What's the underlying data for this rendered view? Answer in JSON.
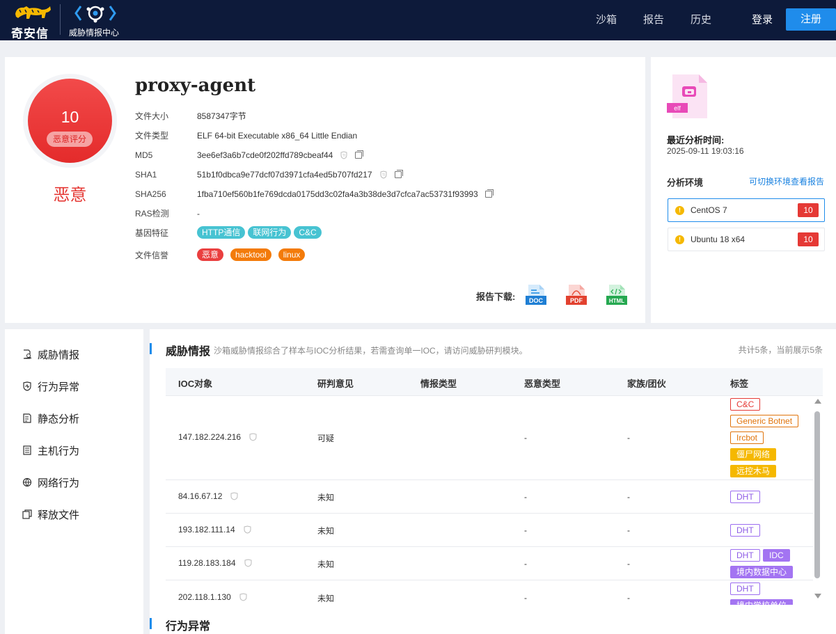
{
  "header": {
    "brand": "奇安信",
    "product": "威胁情报中心",
    "nav": [
      "沙箱",
      "报告",
      "历史"
    ],
    "login": "登录",
    "register": "注册"
  },
  "summary": {
    "score": "10",
    "score_label": "恶意评分",
    "verdict": "恶意",
    "file_name": "proxy-agent",
    "fields": {
      "size_label": "文件大小",
      "size": "8587347字节",
      "type_label": "文件类型",
      "type": "ELF 64-bit Executable x86_64 Little Endian",
      "md5_label": "MD5",
      "md5": "3ee6ef3a6b7cde0f202ffd789cbeaf44",
      "sha1_label": "SHA1",
      "sha1": "51b1f0dbca9e77dcf07d3971cfa4ed5b707fd217",
      "sha256_label": "SHA256",
      "sha256": "1fba710ef560b1fe769dcda0175dd3c02fa4a3b38de3d7cfca7ac53731f93993",
      "ras_label": "RAS检测",
      "ras": "-",
      "gene_label": "基因特征",
      "rep_label": "文件信誉"
    },
    "gene_tags": [
      "HTTP通信",
      "联网行为",
      "C&C"
    ],
    "reputation_tags": [
      "恶意",
      "hacktool",
      "linux"
    ],
    "download_label": "报告下载:",
    "downloads": [
      "DOC",
      "PDF",
      "HTML"
    ]
  },
  "analysis": {
    "file_badge": "elf",
    "latest_label": "最近分析时间:",
    "latest_time": "2025-09-11 19:03:16",
    "env_label": "分析环境",
    "env_link": "可切换环境查看报告",
    "envs": [
      {
        "name": "CentOS 7",
        "score": "10"
      },
      {
        "name": "Ubuntu 18 x64",
        "score": "10"
      }
    ]
  },
  "sidebar": [
    "威胁情报",
    "行为异常",
    "静态分析",
    "主机行为",
    "网络行为",
    "释放文件"
  ],
  "threat": {
    "title": "威胁情报",
    "desc": "沙箱威胁情报综合了样本与IOC分析结果，若需查询单一IOC，请访问威胁研判模块。",
    "count": "共计5条，当前展示5条",
    "columns": [
      "IOC对象",
      "研判意见",
      "情报类型",
      "恶意类型",
      "家族/团伙",
      "标签"
    ],
    "rows": [
      {
        "ioc": "147.182.224.216",
        "opinion": "可疑",
        "mal_type": "-",
        "family": "-"
      },
      {
        "ioc": "84.16.67.12",
        "opinion": "未知",
        "mal_type": "-",
        "family": "-"
      },
      {
        "ioc": "193.182.111.14",
        "opinion": "未知",
        "mal_type": "-",
        "family": "-"
      },
      {
        "ioc": "119.28.183.184",
        "opinion": "未知",
        "mal_type": "-",
        "family": "-"
      },
      {
        "ioc": "202.118.1.130",
        "opinion": "未知",
        "mal_type": "-",
        "family": "-"
      }
    ],
    "row_tags": [
      [
        "C&C",
        "Generic Botnet",
        "Ircbot",
        "僵尸网络",
        "远控木马"
      ],
      [
        "DHT"
      ],
      [
        "DHT"
      ],
      [
        "DHT",
        "IDC",
        "境内数据中心"
      ],
      [
        "DHT",
        "境内学校单位"
      ]
    ]
  },
  "section2_title": "行为异常"
}
